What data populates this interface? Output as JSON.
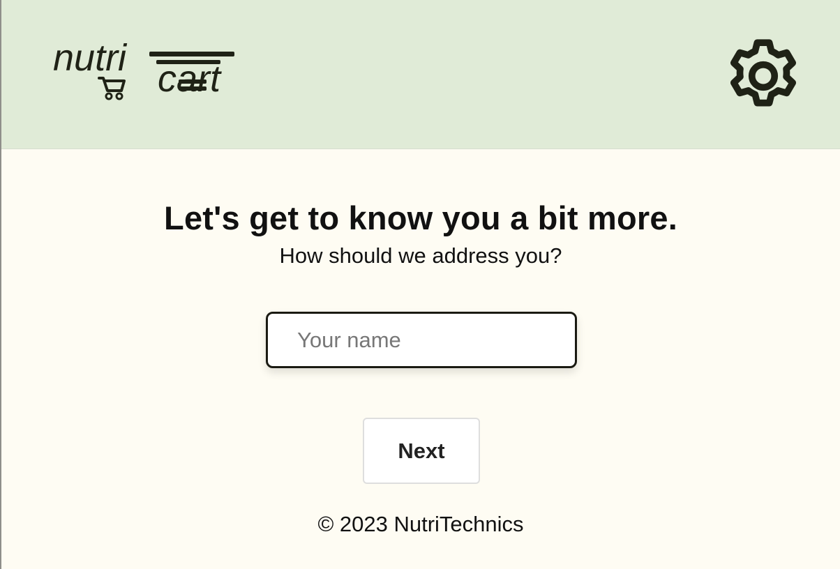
{
  "header": {
    "logo": {
      "line_1": "nutri",
      "line_2": "cart",
      "icon": "shopping-cart-icon"
    },
    "settings_icon": "gear-icon"
  },
  "main": {
    "title": "Let's get to know you a bit more.",
    "subtitle": "How should we address you?",
    "name_input": {
      "placeholder": "Your name",
      "value": ""
    },
    "next_button_label": "Next"
  },
  "footer": {
    "copyright": "© 2023 NutriTechnics"
  },
  "colors": {
    "header_background": "#e0ebd7",
    "page_background": "#fefcf3",
    "text": "#111111",
    "accent_dark": "#1f2216"
  }
}
